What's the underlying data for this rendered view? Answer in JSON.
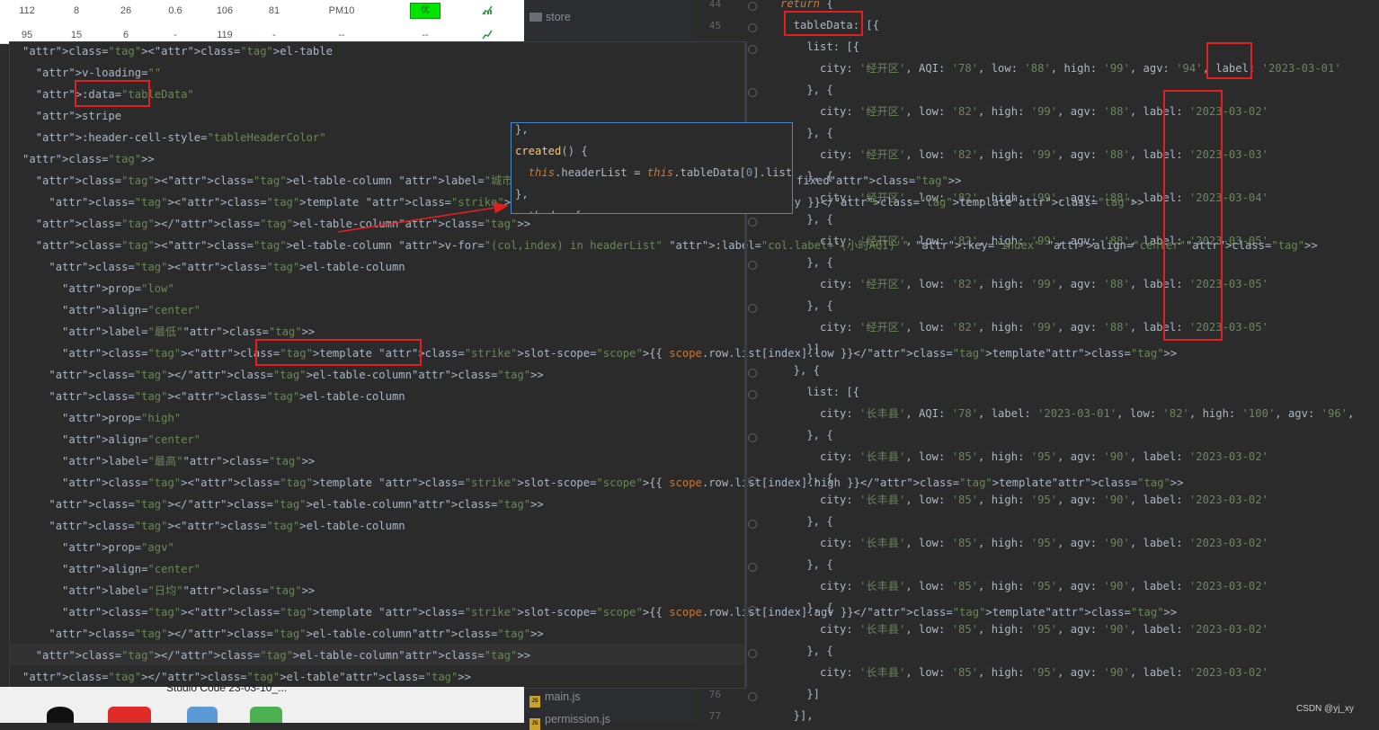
{
  "background_table": {
    "row1": [
      "112",
      "8",
      "26",
      "0.6",
      "106",
      "81",
      "PM10",
      "优"
    ],
    "row2": [
      "95",
      "6",
      "15",
      "-",
      "119",
      "-",
      "--",
      "--"
    ]
  },
  "file_tree": {
    "store": "store",
    "main_js": "main.js",
    "permission_js": "permission.js"
  },
  "gutter": {
    "n44": "44",
    "n45": "45",
    "n76": "76",
    "n77": "77"
  },
  "left_code": [
    "<el-table",
    "  v-loading=\"\"",
    "  :data=\"tableData\"",
    "  stripe",
    "  :header-cell-style=\"tableHeaderColor\"",
    ">",
    "  <el-table-column label=\"城市\" align=\"center\" prop=\"dwmc\" fixed>",
    "    <template slot-scope=\"scope\">{{ scope.row.list[0].city }}</template>",
    "  </el-table-column>",
    "  <el-table-column v-for=\"(col,index) in headerList\" :label=\"col.label+'(小时AQI)'\" :key=\"index\" align=\"center\">",
    "    <el-table-column",
    "      prop=\"low\"",
    "      align=\"center\"",
    "      label=\"最低\">",
    "      <template slot-scope=\"scope\">{{ scope.row.list[index].low }}</template>",
    "    </el-table-column>",
    "    <el-table-column",
    "      prop=\"high\"",
    "      align=\"center\"",
    "      label=\"最高\">",
    "      <template slot-scope=\"scope\">{{ scope.row.list[index].high }}</template>",
    "    </el-table-column>",
    "    <el-table-column",
    "      prop=\"agv\"",
    "      align=\"center\"",
    "      label=\"日均\">",
    "      <template slot-scope=\"scope\">{{ scope.row.list[index].agv }}</template>",
    "    </el-table-column>",
    "  </el-table-column>",
    "</el-table>"
  ],
  "popup_code": [
    "},",
    "created() {",
    "  this.headerList = this.tableData[0].list",
    "},",
    "methods: {"
  ],
  "right_code": [
    "return {",
    "  tableData: [{",
    "    list: [{",
    "      city: '经开区', AQI: '78', low: '88', high: '99', agv: '94', label: '2023-03-01'",
    "    }, {",
    "      city: '经开区', low: '82', high: '99', agv: '88', label: '2023-03-02'",
    "    }, {",
    "      city: '经开区', low: '82', high: '99', agv: '88', label: '2023-03-03'",
    "    }, {",
    "      city: '经开区', low: '82', high: '99', agv: '88', label: '2023-03-04'",
    "    }, {",
    "      city: '经开区', low: '82', high: '99', agv: '88', label: '2023-03-05'",
    "    }, {",
    "      city: '经开区', low: '82', high: '99', agv: '88', label: '2023-03-05'",
    "    }, {",
    "      city: '经开区', low: '82', high: '99', agv: '88', label: '2023-03-05'",
    "    }]",
    "  }, {",
    "    list: [{",
    "      city: '长丰县', AQI: '78', label: '2023-03-01', low: '82', high: '100', agv: '96',",
    "    }, {",
    "      city: '长丰县', low: '85', high: '95', agv: '90', label: '2023-03-02'",
    "    }, {",
    "      city: '长丰县', low: '85', high: '95', agv: '90', label: '2023-03-02'",
    "    }, {",
    "      city: '长丰县', low: '85', high: '95', agv: '90', label: '2023-03-02'",
    "    }, {",
    "      city: '长丰县', low: '85', high: '95', agv: '90', label: '2023-03-02'",
    "    }, {",
    "      city: '长丰县', low: '85', high: '95', agv: '90', label: '2023-03-02'",
    "    }, {",
    "      city: '长丰县', low: '85', high: '95', agv: '90', label: '2023-03-02'",
    "    }]",
    "  }],"
  ],
  "taskbar": {
    "text": "Studio Code  23-03-10_..."
  },
  "watermark": "CSDN @yj_xy",
  "colors": {
    "highlight": "#e02020",
    "editor_bg": "#2b2b2b",
    "tag": "#e8bf6a",
    "string": "#6a8759",
    "keyword": "#cc7832"
  }
}
